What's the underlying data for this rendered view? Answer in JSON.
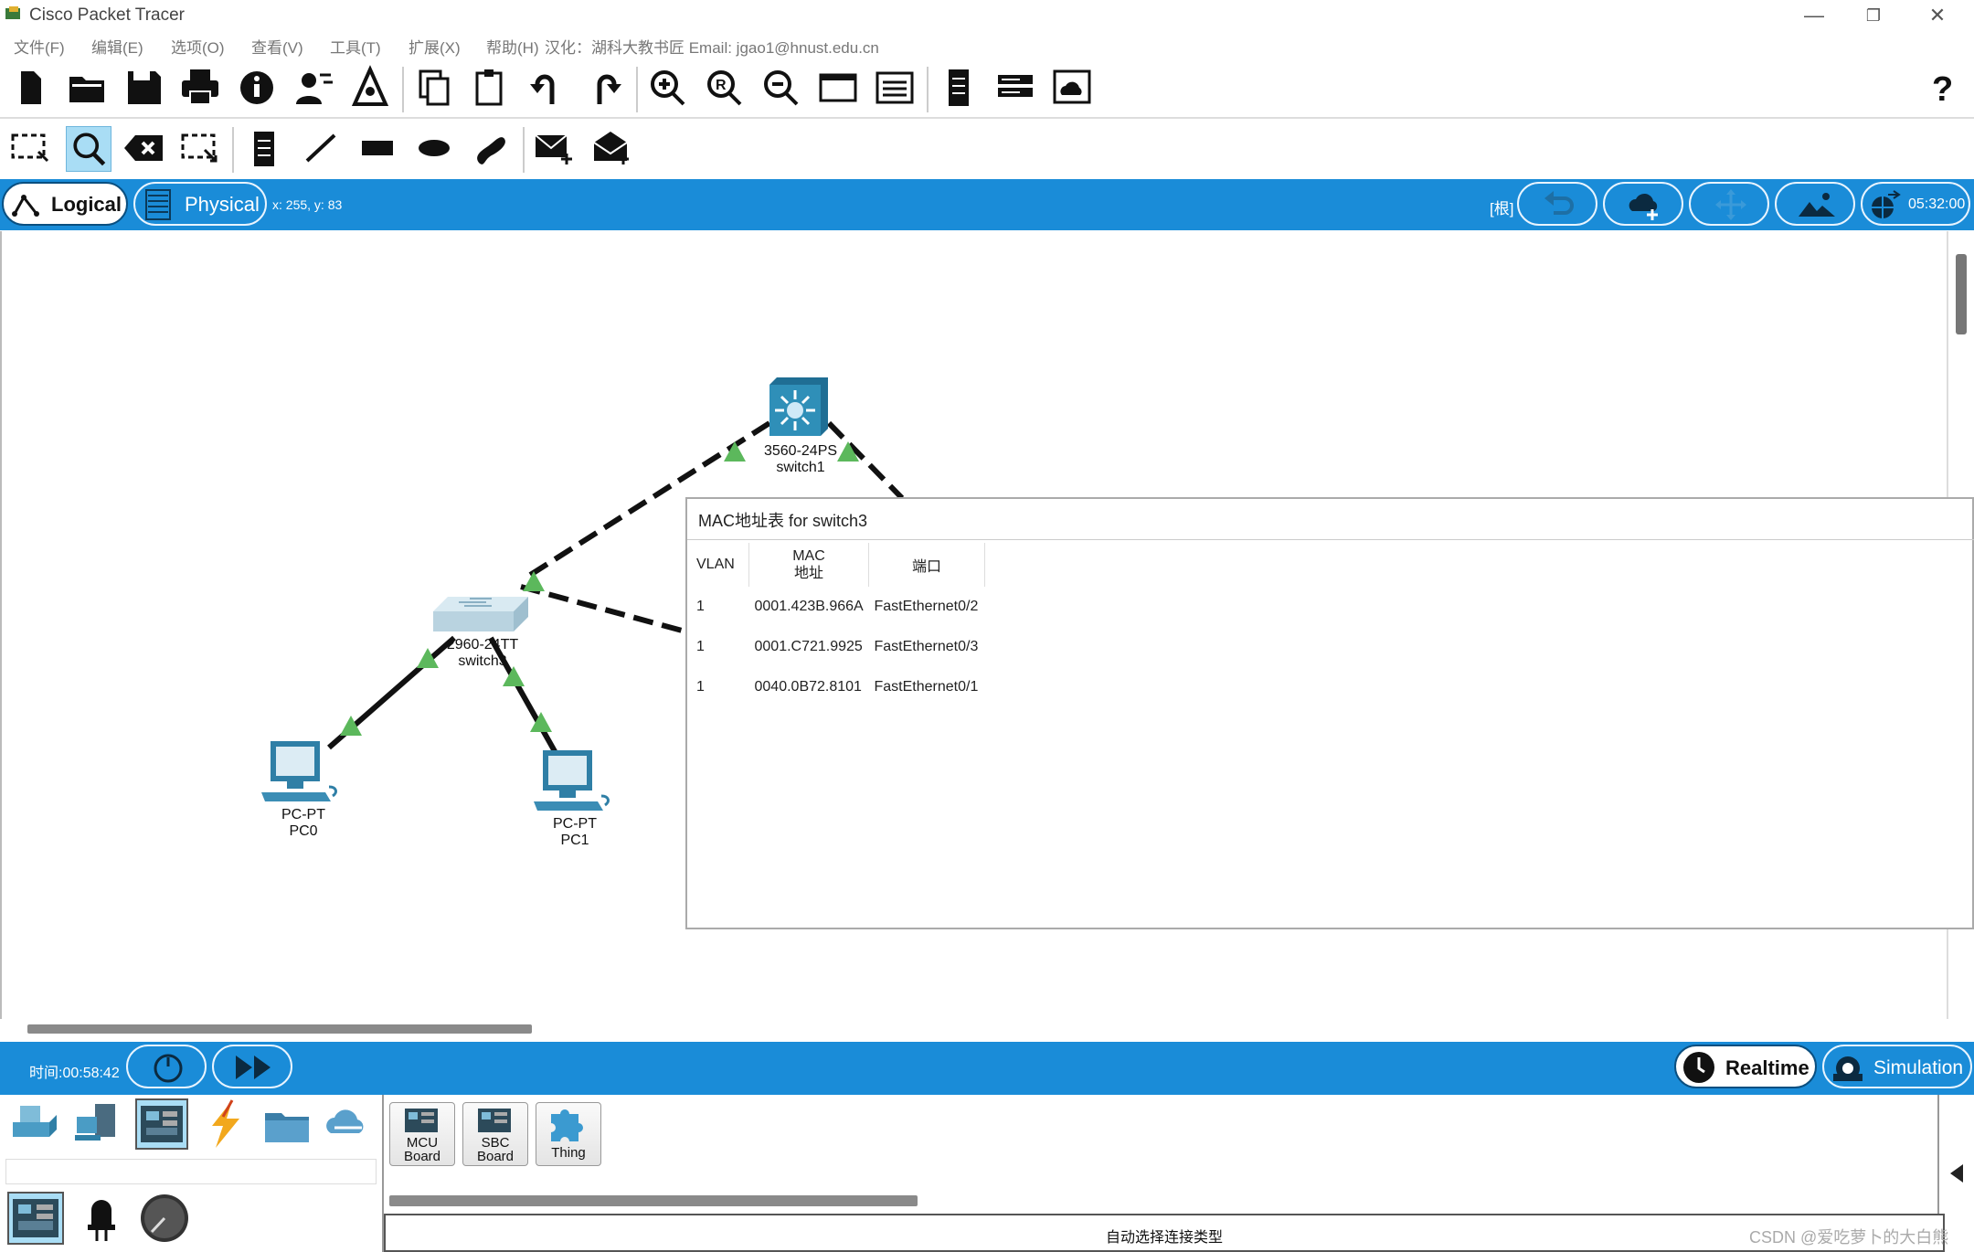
{
  "app": {
    "title": "Cisco Packet Tracer"
  },
  "menu": {
    "items": [
      "文件(F)",
      "编辑(E)",
      "选项(O)",
      "查看(V)",
      "工具(T)",
      "扩展(X)",
      "帮助(H)"
    ],
    "credit": "汉化：湖科大教书匠  Email: jgao1@hnust.edu.cn"
  },
  "modebar": {
    "logical_label": "Logical",
    "physical_label": "Physical",
    "coords": "x: 255, y: 83",
    "root_label": "[根]",
    "clock": "05:32:00"
  },
  "devices": [
    {
      "id": "switch1",
      "model": "3560-24PS",
      "name": "switch1"
    },
    {
      "id": "switch3",
      "model": "2960-24TT",
      "name": "switch3"
    },
    {
      "id": "pc0",
      "model": "PC-PT",
      "name": "PC0"
    },
    {
      "id": "pc1",
      "model": "PC-PT",
      "name": "PC1"
    }
  ],
  "mac_dialog": {
    "title": "MAC地址表 for switch3",
    "headers": {
      "vlan": "VLAN",
      "mac_line1": "MAC",
      "mac_line2": "地址",
      "port": "端口"
    },
    "rows": [
      {
        "vlan": "1",
        "mac": "0001.423B.966A",
        "port": "FastEthernet0/2"
      },
      {
        "vlan": "1",
        "mac": "0001.C721.9925",
        "port": "FastEthernet0/3"
      },
      {
        "vlan": "1",
        "mac": "0040.0B72.8101",
        "port": "FastEthernet0/1"
      }
    ]
  },
  "simbar": {
    "time": "时间:00:58:42",
    "realtime_label": "Realtime",
    "simulation_label": "Simulation"
  },
  "palette": {
    "items": [
      {
        "line1": "MCU",
        "line2": "Board"
      },
      {
        "line1": "SBC",
        "line2": "Board"
      },
      {
        "line1": "Thing",
        "line2": ""
      }
    ],
    "status": "自动选择连接类型"
  },
  "watermark": "CSDN @爱吃萝卜的大白熊",
  "colors": {
    "accent": "#1a8cd8",
    "link_up": "#5cb85c",
    "device_blue": "#2f7fa6"
  }
}
